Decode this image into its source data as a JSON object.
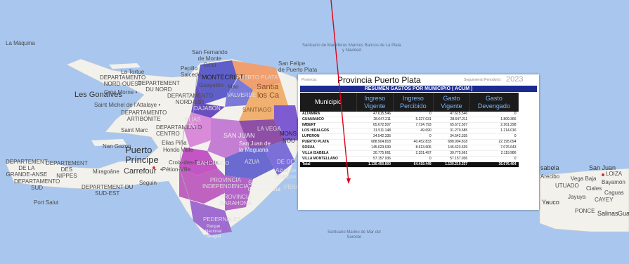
{
  "map": {
    "labels": {
      "la_maquina": "La Máquina",
      "la_tortue": "La Tortue",
      "dep_nord_ouest": "DEPARTAMENTO\nNORD-OUEST",
      "gros_morne": "Gros Morne •",
      "dep_du_nord": "DEPARTEMENT\nDU NORD",
      "les_gonaives": "Les Gonaïves",
      "st_michel": "Saint Michel de l'Attalaye •",
      "dep_nord_est": "DEPARTAMENTO\nNORD-EST",
      "dep_artibonite": "DEPARTAMENTO\nARTIBONITE",
      "saint_marc": "Saint Marc",
      "dep_centro": "DEPARTAMENTO\nCENTRO",
      "nan_gazon": "Nan Gazon",
      "elias_pina_town": "Elias Piña",
      "hondo_valle": "Hondo Valle",
      "puerto_principe": "Puerto\nPríncipe",
      "croix": "Croix-des-Bouquets",
      "petion": "•Pétion-Ville",
      "carrefour": "Carrefour",
      "miragoane": "Miragoâne",
      "dep_de_la_grande_anse": "DEPARTEMENT\nDE LA\nGRANDE-ANSE",
      "dep_nippes": "DEPARTEMENT\nDES\nNIPPES",
      "dep_sud": "DEPARTAMENTO\nSUD",
      "seguin": "Seguin",
      "dep_sud_est": "DEPARTEMENT DU\nSUD-EST",
      "port_salut": "Port Salut",
      "san_fernando": "San Fernando\nde Monte\nCristi",
      "pepillo": "Pepillo\nSalcedo",
      "guayubin": "Guayubín",
      "mao": "Mao",
      "santia": "Santia",
      "san_felipe": "San Felipe\nde Puerto Plata",
      "santuario": "Santuario de Mamíferos Marinos Bancos de La Plata\ny Navidad",
      "montecristi": "MONTECRISTI",
      "puerto_plata_r": "PUERTO PLATA",
      "valverde": "VALVERDE",
      "dajabon": "DAJABÓN",
      "los_ca": "los Ca",
      "santiago": "SANTIAGO",
      "elias_pina": "ELÍAS\nPIÑA",
      "san_juan_r": "SAN JUAN",
      "la_vega": "LA VEGA",
      "mons": "MONS",
      "nou": "NOU",
      "san_juan_town": "San Juan de\nla Maguana",
      "bahoruco": "BAHORUCO",
      "azua_r": "AZUA",
      "de_oc": "DE OC",
      "azua_town": "Azua de\nCompos",
      "provincia_indep": "PROVINCIA\nINDEPENDENCIA",
      "santa_cruz": "Santa Cruz\nde Barahona",
      "peravia": "PERAV",
      "provincia_barahona": "PROVINCIA\nBARAHONA",
      "pedernales": "PEDERNALES",
      "parque_jaragua": "Parque\nNacional\nJaragua",
      "sabela": "sabela",
      "san_juan_pr": "San Juan",
      "loiza": "LOIZA",
      "arecibo": "Arecibo",
      "vega_baja": "Vega Baja",
      "bayamon": "Bayamón",
      "utuado": "UTUADO",
      "ciales": "Ciales",
      "caguas": "Caguas",
      "jayuya": "Jayuya",
      "cayey": "CAYEY",
      "yauco": "Yauco",
      "ponce": "PONCE",
      "salinas": "Salinas",
      "guayama": "Guayama",
      "santuario_sur": "Santuario Marino de Mar del\nSureste"
    }
  },
  "report": {
    "provincia_label": "Provincia:",
    "provincia_value": "Provincia Puerto Plata",
    "seguimiento_label": "Seguimiento Periodo(s):",
    "year": "2023",
    "banner": "RESUMEN GASTOS POR MUNICIPIO ( ACUM )",
    "headers": [
      "Municipio",
      "Ingreso\nVigente",
      "Ingreso\nPercibido",
      "Gasto\nVigente",
      "Gasto\nDevengado"
    ],
    "rows": [
      [
        "ALTAMIRA",
        "47.615.546",
        "0",
        "47.615.546",
        "0"
      ],
      [
        "GUANANICO",
        "28.647.211",
        "5.227.031",
        "28.647.211",
        "1.809.366"
      ],
      [
        "IMBERT",
        "65.672.507",
        "7.724.793",
        "65.672.507",
        "2.261.298"
      ],
      [
        "LOS HIDALGOS",
        "31.511.148",
        "49.690",
        "31.270.685",
        "1.214.016"
      ],
      [
        "LUPERON",
        "34.542.335",
        "0",
        "34.542.335",
        "0"
      ],
      [
        "PUERTO PLATA",
        "688.904.818",
        "40.452.833",
        "688.904.818",
        "22.195.094"
      ],
      [
        "SOSUA",
        "145.623.639",
        "8.613.606",
        "145.623.639",
        "7.076.643"
      ],
      [
        "VILLA ISABELA",
        "30.775.661",
        "2.351.497",
        "30.775.661",
        "2.119.986"
      ],
      [
        "VILLA MONTELLANO",
        "57.157.936",
        "0",
        "57.157.936",
        "0"
      ]
    ],
    "total": [
      "Total",
      "1.130.450.800",
      "64.419.449",
      "1.130.210.337",
      "36.676.404"
    ]
  },
  "colors": {
    "ocean": "#a9c7ee",
    "land": "#f3f1ec",
    "banner": "#1a2a8f",
    "pointer": "#e0001b"
  }
}
